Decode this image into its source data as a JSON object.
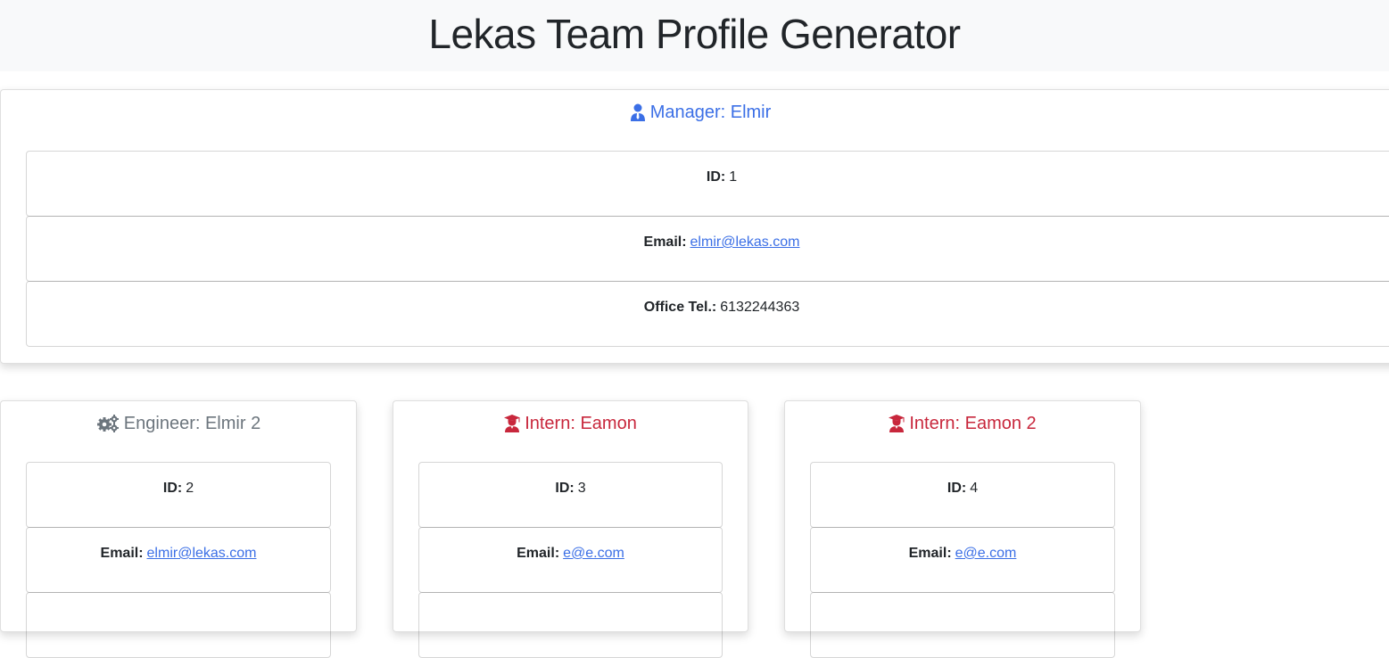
{
  "header": {
    "title": "Lekas Team Profile Generator"
  },
  "manager": {
    "title": "Manager: Elmir",
    "id_label": "ID:",
    "id": "1",
    "email_label": "Email:",
    "email": "elmir@lekas.com",
    "office_label": "Office Tel.:",
    "office": "6132244363"
  },
  "cards": [
    {
      "title": "Engineer: Elmir 2",
      "id_label": "ID:",
      "id": "2",
      "email_label": "Email:",
      "email": "elmir@lekas.com"
    },
    {
      "title": "Intern: Eamon",
      "id_label": "ID:",
      "id": "3",
      "email_label": "Email:",
      "email": "e@e.com"
    },
    {
      "title": "Intern: Eamon 2",
      "id_label": "ID:",
      "id": "4",
      "email_label": "Email:",
      "email": "e@e.com"
    }
  ],
  "colors": {
    "manager": "#3b6fe6",
    "engineer": "#6c757d",
    "intern": "#c8273c",
    "link": "#3b6fe6",
    "header_bg": "#f8f9fa"
  },
  "icons": {
    "manager": "user-tie-icon",
    "engineer": "cogs-icon",
    "intern": "user-graduate-icon"
  }
}
